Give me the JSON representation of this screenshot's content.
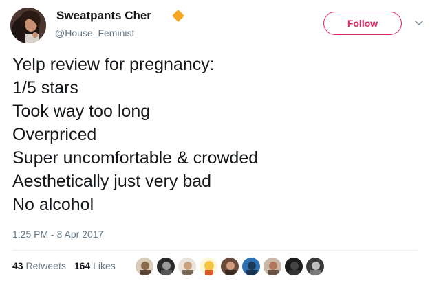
{
  "user": {
    "display_name": "Sweatpants Cher",
    "handle": "@House_Feminist",
    "badge_icon": "orange-diamond-icon",
    "badge_color": "#f7a823"
  },
  "follow_button": {
    "label": "Follow",
    "color": "#e0245e"
  },
  "tweet": {
    "lines": [
      "Yelp review for pregnancy:",
      "1/5 stars",
      "Took way too long",
      "Overpriced",
      "Super uncomfortable & crowded",
      "Aesthetically just very bad",
      "No alcohol"
    ],
    "timestamp": "1:25 PM - 8 Apr 2017"
  },
  "stats": {
    "retweets_count": "43",
    "retweets_label": "Retweets",
    "likes_count": "164",
    "likes_label": "Likes"
  },
  "likers": [
    {
      "icon": "liker-avatar"
    },
    {
      "icon": "liker-avatar"
    },
    {
      "icon": "liker-avatar"
    },
    {
      "icon": "liker-avatar"
    },
    {
      "icon": "liker-avatar"
    },
    {
      "icon": "liker-avatar"
    },
    {
      "icon": "liker-avatar"
    },
    {
      "icon": "liker-avatar"
    },
    {
      "icon": "liker-avatar"
    }
  ]
}
